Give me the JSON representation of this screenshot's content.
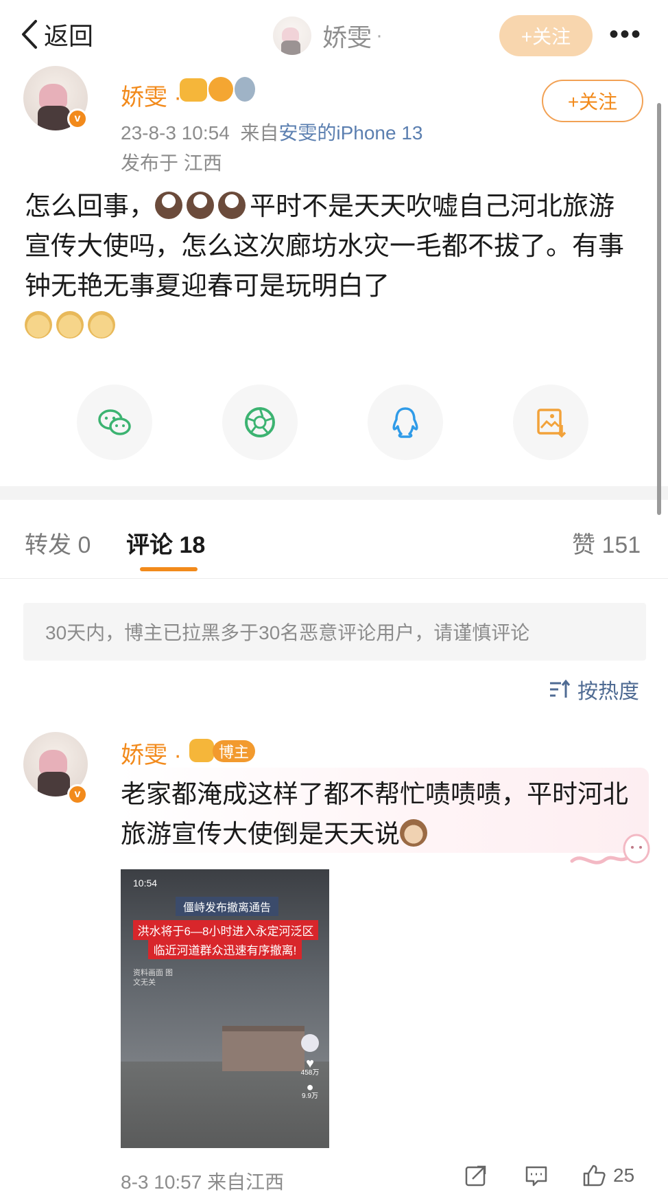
{
  "nav": {
    "back_label": "返回",
    "user_name": "娇雯",
    "dot": "·",
    "follow_label": "+关注",
    "more": "•••"
  },
  "post": {
    "user_name": "娇雯 ·",
    "verified_mark": "v",
    "time": "23-8-3 10:54",
    "source_prefix": "来自",
    "source": "安雯的iPhone 13",
    "location": "发布于 江西",
    "follow_label": "+关注",
    "text_1": "怎么回事，",
    "text_2": "平时不是天天吹嘘自己河北旅游宣传大使吗，怎么这次廊坊水灾一毛都不拔了。有事钟无艳无事夏迎春可是玩明白了"
  },
  "share": {
    "items": [
      "wechat-icon",
      "moments-icon",
      "qq-icon",
      "save-image-icon"
    ],
    "colors": {
      "wechat": "#3cb371",
      "moments": "#3cb371",
      "qq": "#2f9be8",
      "save": "#f2a23a"
    }
  },
  "tabs": {
    "repost": "转发 0",
    "comments": "评论 18",
    "likes": "赞 151"
  },
  "notice": "30天内，博主已拉黑多于30名恶意评论用户，请谨慎评论",
  "sort_label": "按热度",
  "comment": {
    "user_name": "娇雯 ·",
    "badge": "博主",
    "verified_mark": "v",
    "text_1": "老家都淹成这样了都不帮忙啧啧啧，平时河北旅游宣传大使倒是天天说",
    "image": {
      "status_time": "10:54",
      "title": "僵峙发布撤离通告",
      "line1": "洪水将于6—8小时进入永定河泛区",
      "line2": "临近河道群众迅速有序撤离!",
      "caption": "资料画面 图文无关",
      "side_1": "458万",
      "side_2": "9.9万"
    },
    "time": "8-3 10:57",
    "source": "来自江西",
    "like_count": "25"
  },
  "accent": "#f28a1b"
}
